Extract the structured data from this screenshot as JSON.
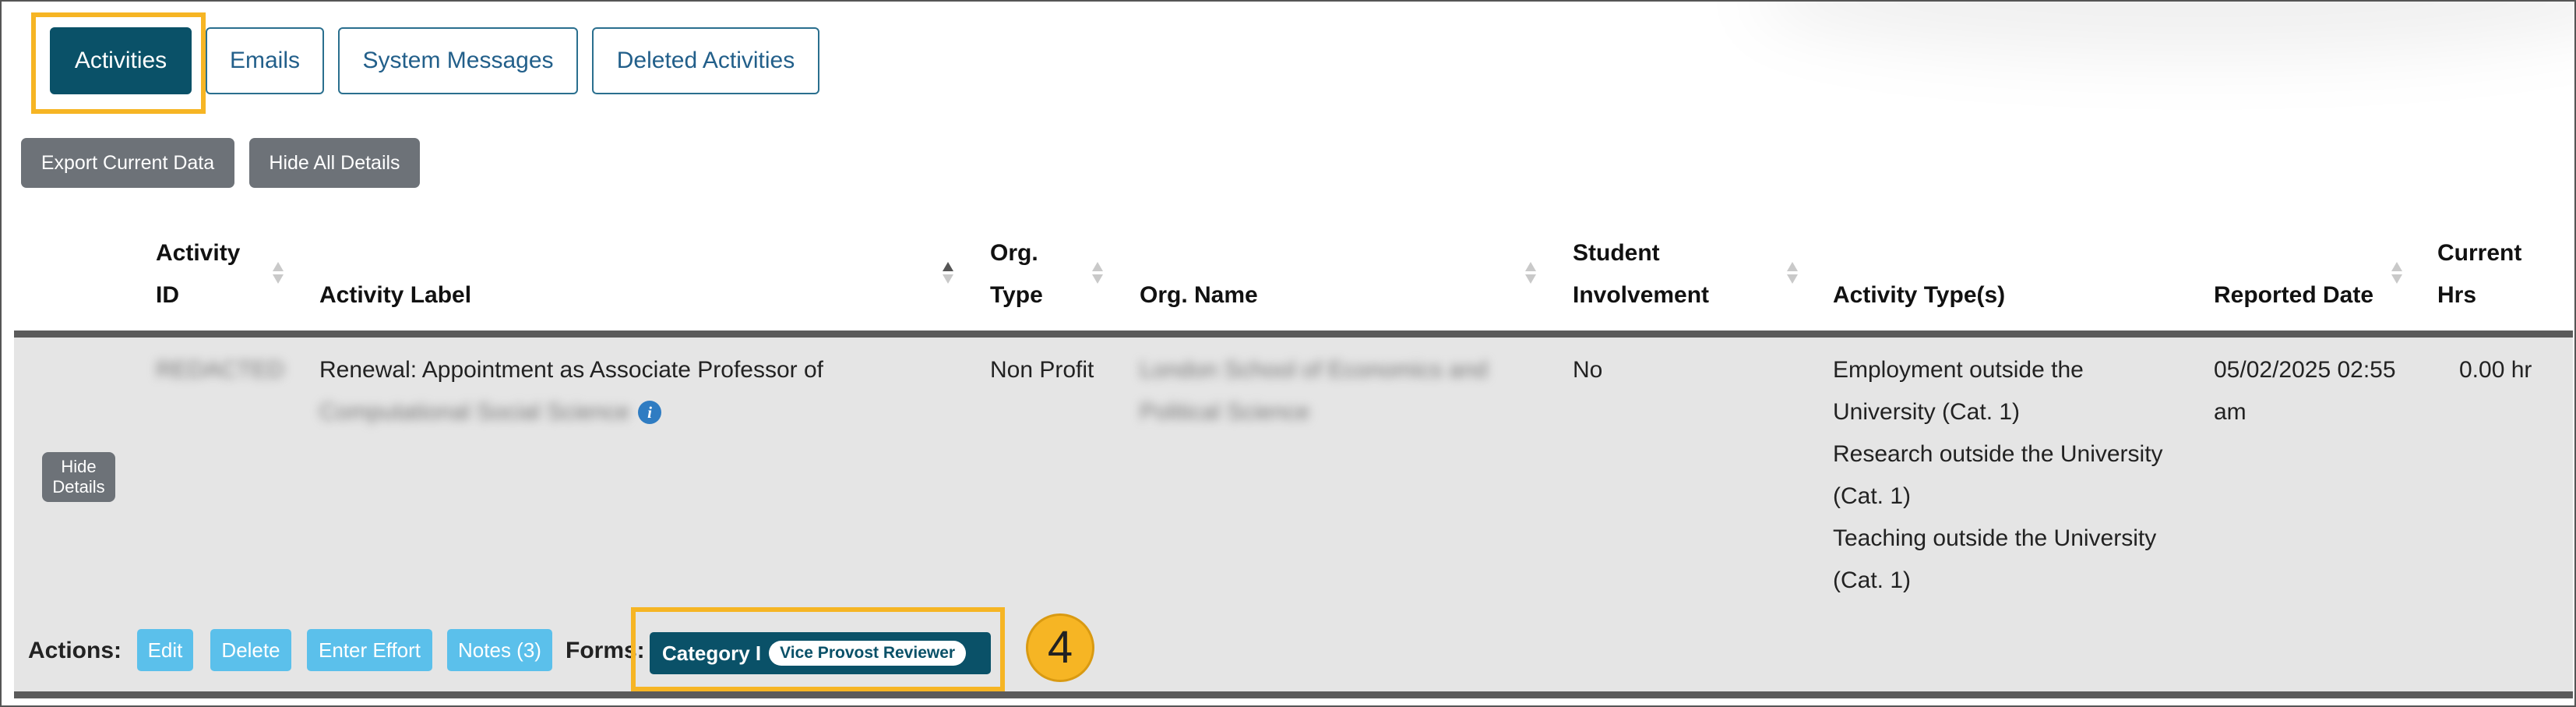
{
  "tabs": [
    {
      "label": "Activities",
      "active": true
    },
    {
      "label": "Emails",
      "active": false
    },
    {
      "label": "System Messages",
      "active": false
    },
    {
      "label": "Deleted Activities",
      "active": false
    }
  ],
  "toolbar": {
    "export_label": "Export Current Data",
    "hide_all_label": "Hide All Details"
  },
  "table": {
    "headers": {
      "activity_id": [
        "Activity",
        "ID"
      ],
      "activity_label": "Activity Label",
      "org_type": [
        "Org.",
        "Type"
      ],
      "org_name": "Org. Name",
      "student_involvement": [
        "Student",
        "Involvement"
      ],
      "activity_types": "Activity Type(s)",
      "reported_date": "Reported Date",
      "current_hrs": [
        "Current",
        "Hrs"
      ]
    },
    "row": {
      "hide_details_label": [
        "Hide",
        "Details"
      ],
      "activity_id": "REDACTED",
      "activity_label": "Renewal: Appointment as Associate Professor of",
      "activity_label_line2": "Computational Social Science",
      "org_type": "Non Profit",
      "org_name_line1": "London School of Economics and",
      "org_name_line2": "Political Science",
      "student_involvement": "No",
      "activity_types": [
        "Employment outside the",
        "University (Cat. 1)",
        "Research outside the University",
        "(Cat. 1)",
        "Teaching outside the University",
        "(Cat. 1)"
      ],
      "reported_date": [
        "05/02/2025 02:55",
        "am"
      ],
      "current_hrs": "0.00 hr"
    },
    "actions": {
      "label": "Actions:",
      "buttons": [
        "Edit",
        "Delete",
        "Enter Effort",
        "Notes (3)"
      ],
      "forms_label": "Forms:",
      "form_name": "Category I",
      "form_badge": "Vice Provost Reviewer"
    }
  },
  "annotation": {
    "step_number": "4",
    "highlight_color": "#f6b524"
  },
  "colors": {
    "primary": "#0a5168",
    "action_button": "#5bc0eb",
    "gray_button": "#6d7278"
  }
}
